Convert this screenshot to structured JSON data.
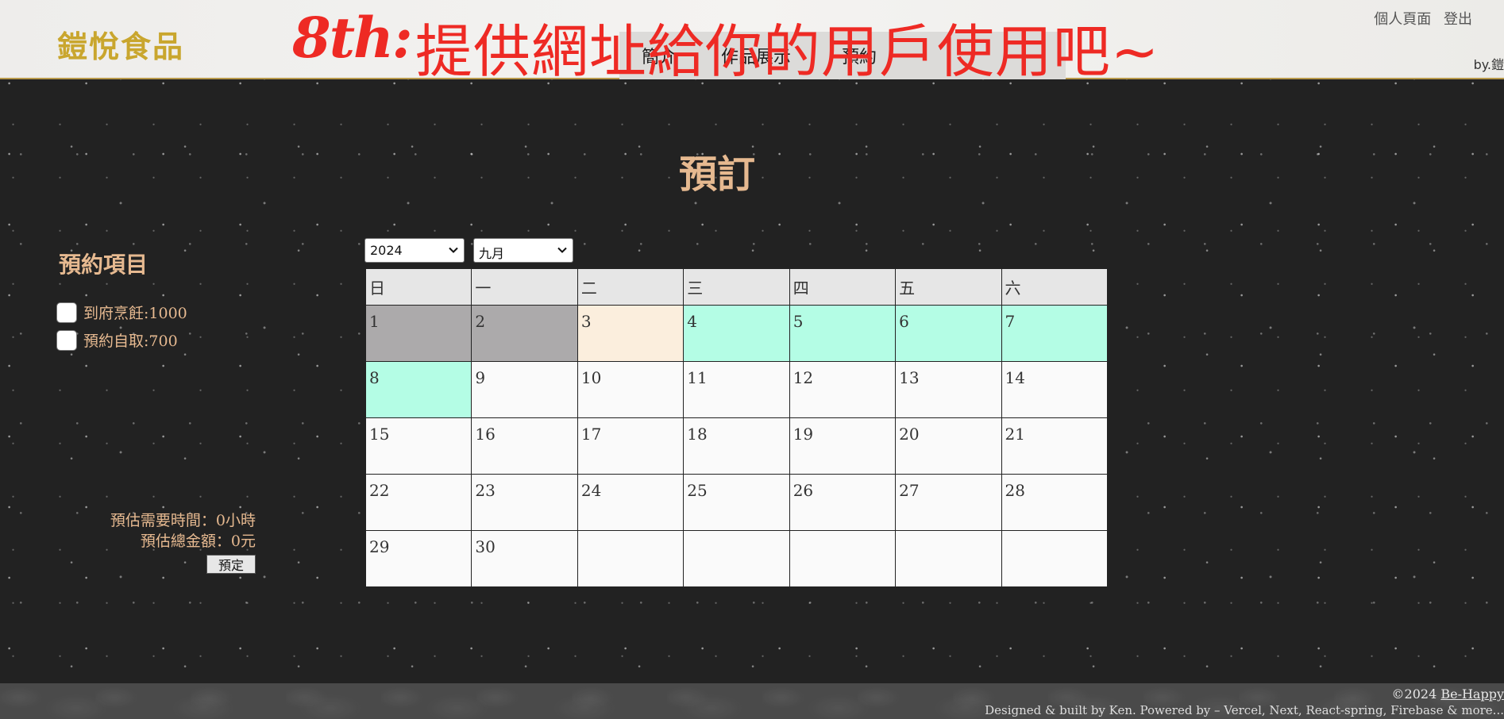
{
  "header": {
    "brand": "鎧悅食品",
    "nav": {
      "intro": "簡介",
      "works": "作品展示",
      "booking": "預約"
    },
    "promo": {
      "tag": "8th:",
      "text": "提供網址給你的用戶使用吧~"
    },
    "user_links": {
      "profile": "個人頁面",
      "logout": "登出"
    },
    "byline": "by.鎧"
  },
  "main": {
    "title": "預訂",
    "sidebar": {
      "title": "預約項目",
      "options": [
        {
          "label": "到府烹飪:1000",
          "checked": false
        },
        {
          "label": "預約自取:700",
          "checked": false
        }
      ],
      "estimate_time": "預估需要時間：0小時",
      "estimate_total": "預估總金額：0元",
      "reserve_label": "預定"
    },
    "year_select": {
      "value": "2024"
    },
    "month_select": {
      "value": "九月"
    },
    "weekdays": [
      "日",
      "一",
      "二",
      "三",
      "四",
      "五",
      "六"
    ],
    "weeks": [
      [
        {
          "day": "1",
          "state": "past"
        },
        {
          "day": "2",
          "state": "past"
        },
        {
          "day": "3",
          "state": "today"
        },
        {
          "day": "4",
          "state": "available"
        },
        {
          "day": "5",
          "state": "available"
        },
        {
          "day": "6",
          "state": "available"
        },
        {
          "day": "7",
          "state": "available"
        }
      ],
      [
        {
          "day": "8",
          "state": "available"
        },
        {
          "day": "9",
          "state": "normal"
        },
        {
          "day": "10",
          "state": "normal"
        },
        {
          "day": "11",
          "state": "normal"
        },
        {
          "day": "12",
          "state": "normal"
        },
        {
          "day": "13",
          "state": "normal"
        },
        {
          "day": "14",
          "state": "normal"
        }
      ],
      [
        {
          "day": "15",
          "state": "normal"
        },
        {
          "day": "16",
          "state": "normal"
        },
        {
          "day": "17",
          "state": "normal"
        },
        {
          "day": "18",
          "state": "normal"
        },
        {
          "day": "19",
          "state": "normal"
        },
        {
          "day": "20",
          "state": "normal"
        },
        {
          "day": "21",
          "state": "normal"
        }
      ],
      [
        {
          "day": "22",
          "state": "normal"
        },
        {
          "day": "23",
          "state": "normal"
        },
        {
          "day": "24",
          "state": "normal"
        },
        {
          "day": "25",
          "state": "normal"
        },
        {
          "day": "26",
          "state": "normal"
        },
        {
          "day": "27",
          "state": "normal"
        },
        {
          "day": "28",
          "state": "normal"
        }
      ],
      [
        {
          "day": "29",
          "state": "normal"
        },
        {
          "day": "30",
          "state": "normal"
        },
        {
          "day": "",
          "state": "normal"
        },
        {
          "day": "",
          "state": "normal"
        },
        {
          "day": "",
          "state": "normal"
        },
        {
          "day": "",
          "state": "normal"
        },
        {
          "day": "",
          "state": "normal"
        }
      ]
    ]
  },
  "footer": {
    "copyright": "©2024",
    "copyright_link": "Be-Happy",
    "credits": "Designed & built by Ken. Powered by – Vercel, Next, React-spring, Firebase & more..."
  },
  "colors": {
    "accent": "#e6b990",
    "brand": "#c9a62e",
    "promo": "#ee2a24",
    "past_day": "#acaaab",
    "today": "#fbeedd",
    "available_day": "#b4fde5"
  },
  "icons": {
    "select_arrow": "chevron-down-icon"
  }
}
